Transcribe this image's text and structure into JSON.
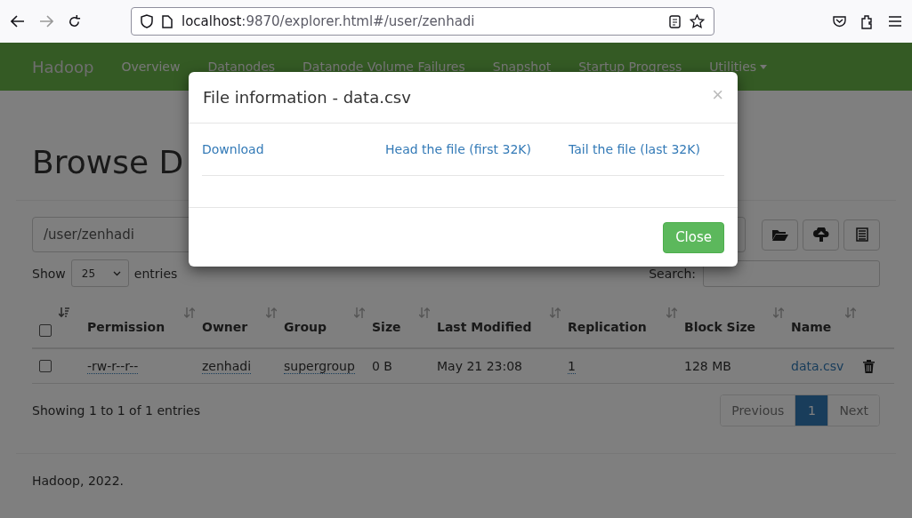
{
  "browser": {
    "url_host": "localhost",
    "url_rest": ":9870/explorer.html#/user/zenhadi"
  },
  "navbar": {
    "brand": "Hadoop",
    "items": [
      {
        "label": "Overview"
      },
      {
        "label": "Datanodes"
      },
      {
        "label": "Datanode Volume Failures"
      },
      {
        "label": "Snapshot"
      },
      {
        "label": "Startup Progress"
      },
      {
        "label": "Utilities",
        "dropdown": true
      }
    ]
  },
  "heading": "Browse D",
  "path_field": {
    "value": "/user/zenhadi"
  },
  "show_entries": {
    "before": "Show",
    "value": "25",
    "after": "entries"
  },
  "search": {
    "label": "Search:"
  },
  "table": {
    "columns": [
      {
        "kind": "checkbox",
        "checked": false,
        "sorted": true
      },
      {
        "label": "Permission",
        "sorted": false
      },
      {
        "label": "Owner",
        "sorted": false
      },
      {
        "label": "Group",
        "sorted": false
      },
      {
        "label": "Size",
        "sorted": false
      },
      {
        "label": "Last Modified",
        "sorted": false
      },
      {
        "label": "Replication",
        "sorted": false
      },
      {
        "label": "Block Size",
        "sorted": false
      },
      {
        "label": "Name",
        "sorted": false
      }
    ],
    "rows": [
      {
        "checked": false,
        "permission": "-rw-r--r--",
        "owner": "zenhadi",
        "group": "supergroup",
        "size": "0 B",
        "modified": "May 21 23:08",
        "replication": "1",
        "block_size": "128 MB",
        "name": "data.csv"
      }
    ]
  },
  "info": "Showing 1 to 1 of 1 entries",
  "pagination": [
    {
      "label": "Previous",
      "selected": false
    },
    {
      "label": "1",
      "selected": true
    },
    {
      "label": "Next",
      "selected": false
    }
  ],
  "footer": "Hadoop, 2022.",
  "modal": {
    "title": "File information - data.csv",
    "close": "×",
    "links": [
      "Download",
      "Head the file (first 32K)",
      "Tail the file (last 32K)"
    ],
    "button": "Close"
  }
}
